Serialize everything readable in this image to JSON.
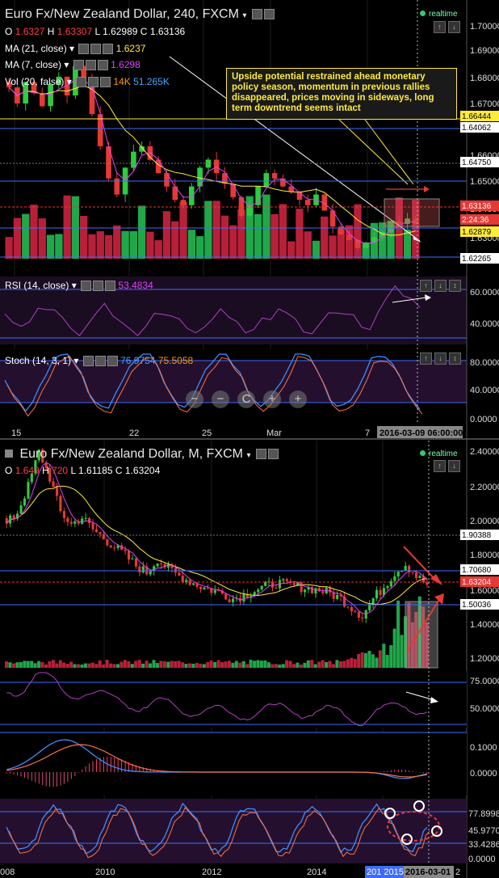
{
  "top": {
    "title": "Euro Fx/New Zealand Dollar, 240, FXCM",
    "realtime": "realtime",
    "ohlc": {
      "o_label": "O",
      "o": "1.6327",
      "h_label": "H",
      "h": "1.63307",
      "l_label": "L",
      "l": "1.62989",
      "c_label": "C",
      "c": "1.63136"
    },
    "ma21": {
      "label": "MA (21, close)",
      "value": "1.6237"
    },
    "ma7": {
      "label": "MA (7, close)",
      "value": "1.6298"
    },
    "vol": {
      "label": "Vol (20, false)",
      "value_a": "14K",
      "value_b": "51.265K"
    },
    "annotation": "Upside potential restrained ahead monetary policy season, momentum in previous rallies disappeared, prices moving in sideways, long term downtrend seems intact",
    "price_ticks": [
      "1.70000",
      "1.69000",
      "1.68000",
      "1.67000",
      "1.66000",
      "1.65000",
      "1.64000",
      "1.63000",
      "1.62000"
    ],
    "price_tags": [
      {
        "text": "1.66444",
        "bg": "#ffeb3b",
        "fg": "#000"
      },
      {
        "text": "1.64062",
        "bg": "#ffffff",
        "fg": "#000"
      },
      {
        "text": "1.64750",
        "bg": "#ffffff",
        "fg": "#000"
      },
      {
        "text": "1.63136",
        "bg": "#e53935",
        "fg": "#fff"
      },
      {
        "text": "2:24:36",
        "bg": "#e53935",
        "fg": "#fff"
      },
      {
        "text": "1.62879",
        "bg": "#ffeb3b",
        "fg": "#000"
      },
      {
        "text": "1.62265",
        "bg": "#ffffff",
        "fg": "#000"
      }
    ],
    "rsi": {
      "label": "RSI (14, close)",
      "value": "53.4834",
      "ticks": [
        "60.0000",
        "40.0000"
      ]
    },
    "stoch": {
      "label": "Stoch (14, 3, 1)",
      "value_a": "76.9754",
      "value_b": "75.5058",
      "ticks": [
        "80.0000",
        "40.0000",
        "0.0000"
      ]
    },
    "xaxis": [
      "15",
      "22",
      "25",
      "Mar",
      "7"
    ],
    "xaxis_tag": "2016-03-09 06:00:00",
    "zoom_buttons": [
      "−",
      "−",
      "C",
      "+",
      "+"
    ]
  },
  "bottom": {
    "title": "Euro Fx/New Zealand Dollar, M, FXCM",
    "realtime": "realtime",
    "ohlc": {
      "o_label": "O",
      "o": "1.649",
      "h_label": "H",
      "h": "720",
      "l_label": "L",
      "l": "1.61185",
      "c_label": "C",
      "c": "1.63204"
    },
    "price_ticks": [
      "2.40000",
      "2.20000",
      "2.00000",
      "1.80000",
      "1.60000",
      "1.40000",
      "1.20000"
    ],
    "price_tags": [
      {
        "text": "1.90388",
        "bg": "#ffffff",
        "fg": "#000"
      },
      {
        "text": "1.70680",
        "bg": "#ffffff",
        "fg": "#000"
      },
      {
        "text": "1.63204",
        "bg": "#e53935",
        "fg": "#fff"
      },
      {
        "text": "1.50036",
        "bg": "#ffffff",
        "fg": "#000"
      }
    ],
    "rsi_ticks": [
      "75.0000",
      "50.0000"
    ],
    "macd_ticks": [
      "0.1000",
      "0.0000"
    ],
    "stoch_ticks": [
      "77.8998",
      "45.9770",
      "33.4286",
      "0.0000"
    ],
    "xaxis": [
      "008",
      "2010",
      "2012",
      "2014"
    ],
    "xaxis_tags": [
      "201 2015",
      "2016-03-01",
      "2"
    ]
  },
  "chart_data": [
    {
      "type": "candlestick",
      "title": "Euro Fx/New Zealand Dollar, 240, FXCM",
      "timeframe": "240",
      "x_labels": [
        "15",
        "22",
        "25",
        "Mar",
        "7"
      ],
      "ylim": [
        1.618,
        1.705
      ],
      "close_series": [
        1.682,
        1.676,
        1.684,
        1.68,
        1.675,
        1.683,
        1.686,
        1.679,
        1.69,
        1.685,
        1.672,
        1.66,
        1.648,
        1.642,
        1.652,
        1.658,
        1.66,
        1.655,
        1.65,
        1.645,
        1.64,
        1.638,
        1.645,
        1.652,
        1.655,
        1.65,
        1.646,
        1.641,
        1.634,
        1.638,
        1.645,
        1.65,
        1.648,
        1.645,
        1.643,
        1.64,
        1.638,
        1.642,
        1.636,
        1.63,
        1.627,
        1.625,
        1.622,
        1.624,
        1.626,
        1.628,
        1.632,
        1.631,
        1.633,
        1.631
      ],
      "indicators": [
        {
          "name": "MA (21, close)",
          "value": 1.6237
        },
        {
          "name": "MA (7, close)",
          "value": 1.6298
        },
        {
          "name": "Vol (20, false)",
          "value": "51.265K"
        },
        {
          "name": "RSI (14, close)",
          "value": 53.4834
        },
        {
          "name": "Stoch (14, 3, 1)",
          "values": [
            76.9754,
            75.5058
          ]
        }
      ],
      "annotation": "Upside potential restrained ahead monetary policy season, momentum in previous rallies disappeared, prices moving in sideways, long term downtrend seems intact"
    },
    {
      "type": "candlestick",
      "title": "Euro Fx/New Zealand Dollar, M, FXCM",
      "timeframe": "M",
      "x_labels": [
        "008",
        "2010",
        "2012",
        "2014"
      ],
      "ylim": [
        1.15,
        2.45
      ],
      "close_series": [
        1.98,
        2.05,
        2.2,
        2.4,
        2.25,
        2.05,
        1.98,
        2.02,
        1.95,
        1.9,
        1.85,
        1.8,
        1.74,
        1.7,
        1.78,
        1.72,
        1.68,
        1.65,
        1.62,
        1.6,
        1.58,
        1.55,
        1.57,
        1.6,
        1.62,
        1.64,
        1.63,
        1.62,
        1.61,
        1.6,
        1.58,
        1.55,
        1.5,
        1.45,
        1.55,
        1.62,
        1.7,
        1.75,
        1.68,
        1.63
      ]
    }
  ]
}
